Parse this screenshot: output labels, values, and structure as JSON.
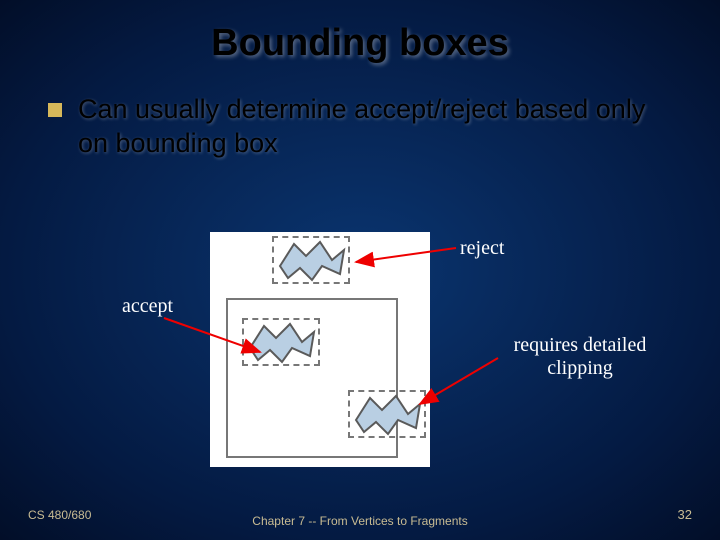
{
  "title": "Bounding boxes",
  "bullet": "Can usually determine accept/reject based only on bounding box",
  "labels": {
    "reject": "reject",
    "accept": "accept",
    "detail": "requires detailed clipping"
  },
  "footer": {
    "left": "CS 480/680",
    "center": "Chapter 7 -- From Vertices to Fragments",
    "page": "32"
  },
  "diagram": {
    "polyFill": "#b9cfe3",
    "polyStroke": "#5a5a5a"
  }
}
